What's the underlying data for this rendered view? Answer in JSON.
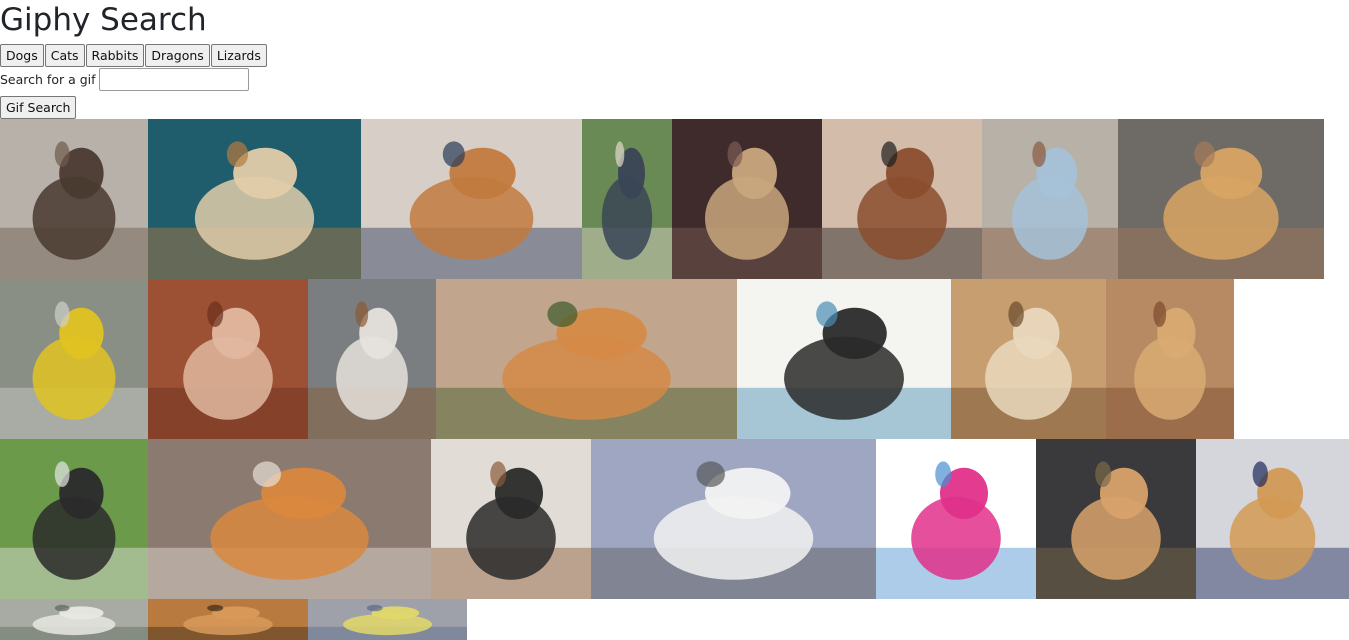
{
  "header": {
    "title": "Giphy Search"
  },
  "topics": [
    "Dogs",
    "Cats",
    "Rabbits",
    "Dragons",
    "Lizards"
  ],
  "search": {
    "label": "Search for a gif",
    "value": "",
    "button_label": "Gif Search"
  },
  "gifs": [
    {
      "name": "gif-dog-standing-at-gate",
      "palette": [
        "#b7b1aa",
        "#4a3a30",
        "#6d5a4c"
      ]
    },
    {
      "name": "gif-three-dogs-posing",
      "palette": [
        "#1f5d6c",
        "#e1ccaa",
        "#b87a3d"
      ]
    },
    {
      "name": "gif-shiba-on-laptop",
      "palette": [
        "#d7cfc7",
        "#c27a3e",
        "#2a3a5a"
      ]
    },
    {
      "name": "gif-woman-by-car",
      "palette": [
        "#6a8a55",
        "#3a4556",
        "#e3d8cc"
      ]
    },
    {
      "name": "gif-pug-on-bed",
      "palette": [
        "#3f2a2c",
        "#c9a77d",
        "#7a5d55"
      ]
    },
    {
      "name": "gif-dachshund-on-floor",
      "palette": [
        "#d3bcaa",
        "#8a4e2e",
        "#1c1c1c"
      ]
    },
    {
      "name": "gif-dogs-on-leashes",
      "palette": [
        "#b7b1a8",
        "#a4c2d8",
        "#8a5a3e"
      ]
    },
    {
      "name": "gif-golden-retriever",
      "palette": [
        "#6e6a66",
        "#d8a463",
        "#a57a59"
      ]
    },
    {
      "name": "gif-excavator",
      "palette": [
        "#8a8f86",
        "#e0c320",
        "#cfcfcb"
      ]
    },
    {
      "name": "gif-child-with-corgi",
      "palette": [
        "#9c5034",
        "#e1b8a0",
        "#6b2f1c"
      ]
    },
    {
      "name": "gif-dogs-hugging-by-river",
      "palette": [
        "#7a7e80",
        "#e6e2dc",
        "#8a5a32"
      ]
    },
    {
      "name": "gif-corgi-lying-down",
      "palette": [
        "#c2a58d",
        "#d58a47",
        "#3c5a2a"
      ]
    },
    {
      "name": "gif-good-morning-cartoon",
      "palette": [
        "#f4f4f1",
        "#2a2a2a",
        "#4a8fb3"
      ]
    },
    {
      "name": "gif-lab-with-bubble",
      "palette": [
        "#c79e70",
        "#ead8bd",
        "#6b4a2c"
      ]
    },
    {
      "name": "gif-golden-pups-standing",
      "palette": [
        "#b78a63",
        "#d9aa72",
        "#7a4a2c"
      ]
    },
    {
      "name": "gif-puppies-in-grass",
      "palette": [
        "#6a9a4a",
        "#2a2a2a",
        "#e6e6e6"
      ]
    },
    {
      "name": "gif-pomeranian-with-towel",
      "palette": [
        "#8a7a70",
        "#d9883e",
        "#e8e0d6"
      ]
    },
    {
      "name": "gif-husky-puppy",
      "palette": [
        "#e2dcd6",
        "#2a2a2a",
        "#8a5a3a"
      ]
    },
    {
      "name": "gif-chinese-crested-wind",
      "palette": [
        "#9ea6c2",
        "#f2f2f2",
        "#5a5a5a"
      ]
    },
    {
      "name": "gif-sleeping-cartoon",
      "palette": [
        "#ffffff",
        "#e0308a",
        "#4a8fcf"
      ]
    },
    {
      "name": "gif-dog-riding-tortoise",
      "palette": [
        "#3a3a3c",
        "#d8a26b",
        "#7a6a4a"
      ]
    },
    {
      "name": "gif-bulldog-puppies-in-bed",
      "palette": [
        "#d4d6dc",
        "#d29a54",
        "#1e2a5a"
      ]
    },
    {
      "name": "gif-car-window",
      "palette": [
        "#a8aaa4",
        "#e6e8e2",
        "#5a6a5a"
      ]
    },
    {
      "name": "gif-brown-dog-closeup",
      "palette": [
        "#b87a3e",
        "#d89a5a",
        "#3a2a1a"
      ]
    },
    {
      "name": "gif-pixel-street",
      "palette": [
        "#9ea0aa",
        "#e2d86a",
        "#5a6a8a"
      ]
    }
  ]
}
